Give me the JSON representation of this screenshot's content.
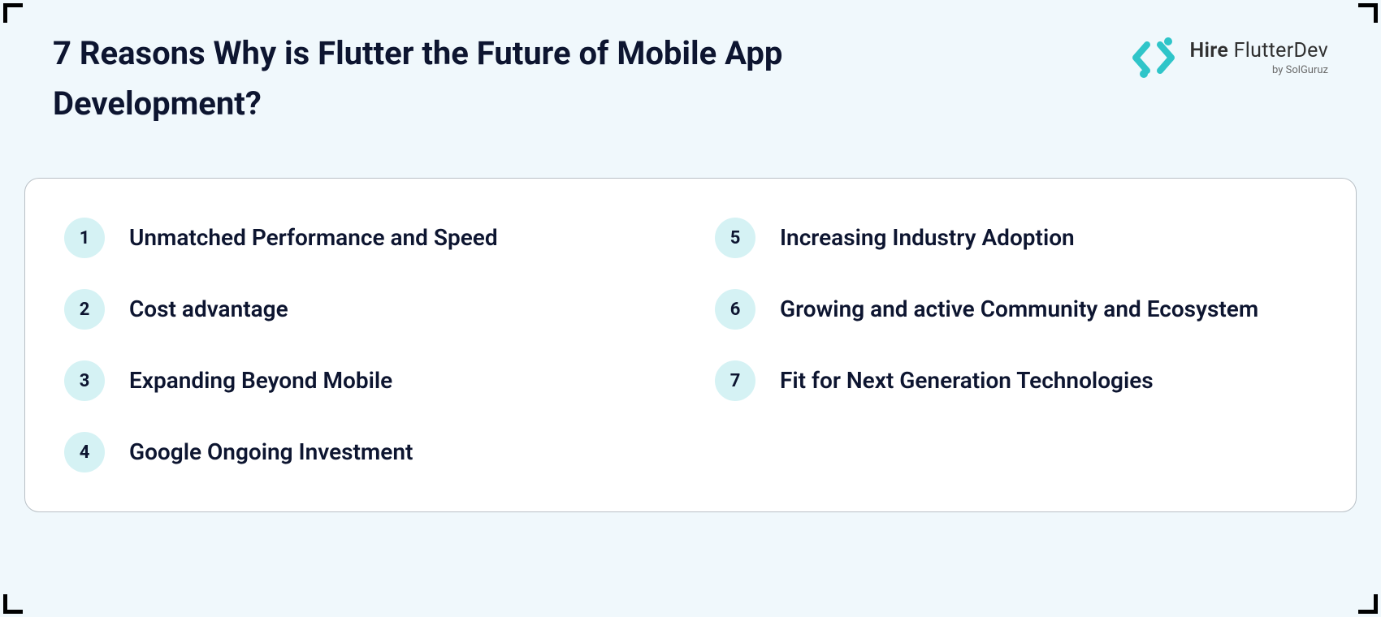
{
  "title": "7 Reasons Why is Flutter the Future of Mobile App Development?",
  "logo": {
    "brand_bold": "Hire",
    "brand_rest": " FlutterDev",
    "sub": "by SolGuruz"
  },
  "reasons_left": [
    {
      "n": "1",
      "text": "Unmatched Performance and Speed"
    },
    {
      "n": "2",
      "text": "Cost advantage"
    },
    {
      "n": "3",
      "text": "Expanding Beyond Mobile"
    },
    {
      "n": "4",
      "text": "Google Ongoing Investment"
    }
  ],
  "reasons_right": [
    {
      "n": "5",
      "text": "Increasing Industry Adoption"
    },
    {
      "n": "6",
      "text": "Growing and active Community and Ecosystem"
    },
    {
      "n": "7",
      "text": "Fit for Next Generation Technologies"
    }
  ]
}
